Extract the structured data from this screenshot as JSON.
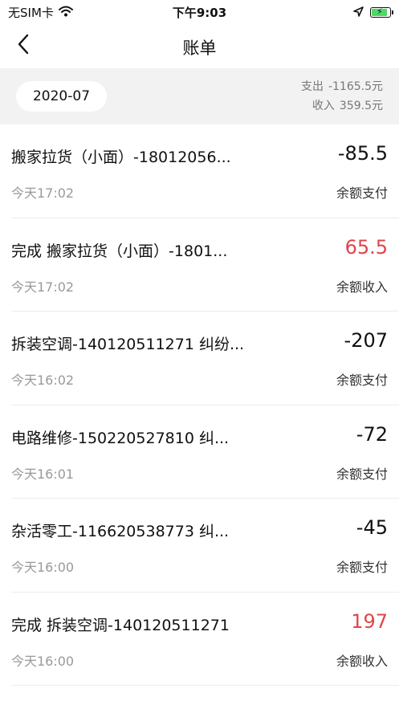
{
  "status_bar": {
    "carrier": "无SIM卡",
    "time": "下午9:03"
  },
  "nav": {
    "title": "账单",
    "back_icon": "chevron-left-icon"
  },
  "summary": {
    "month": "2020-07",
    "expense_label": "支出",
    "expense_value": "-1165.5元",
    "income_label": "收入",
    "income_value": "359.5元"
  },
  "colors": {
    "income_amount": "#e0454b",
    "summary_bg": "#f2f2f2",
    "battery": "#4cd964"
  },
  "bills": [
    {
      "title": "搬家拉货（小面）-18012056...",
      "time": "今天17:02",
      "amount": "-85.5",
      "type": "余额支付",
      "kind": "expense"
    },
    {
      "title": "完成 搬家拉货（小面）-1801...",
      "time": "今天17:02",
      "amount": "65.5",
      "type": "余额收入",
      "kind": "income"
    },
    {
      "title": "拆装空调-140120511271 纠纷...",
      "time": "今天16:02",
      "amount": "-207",
      "type": "余额支付",
      "kind": "expense"
    },
    {
      "title": "电路维修-150220527810 纠...",
      "time": "今天16:01",
      "amount": "-72",
      "type": "余额支付",
      "kind": "expense"
    },
    {
      "title": "杂活零工-116620538773 纠...",
      "time": "今天16:00",
      "amount": "-45",
      "type": "余额支付",
      "kind": "expense"
    },
    {
      "title": "完成 拆装空调-140120511271",
      "time": "今天16:00",
      "amount": "197",
      "type": "余额收入",
      "kind": "income"
    }
  ]
}
